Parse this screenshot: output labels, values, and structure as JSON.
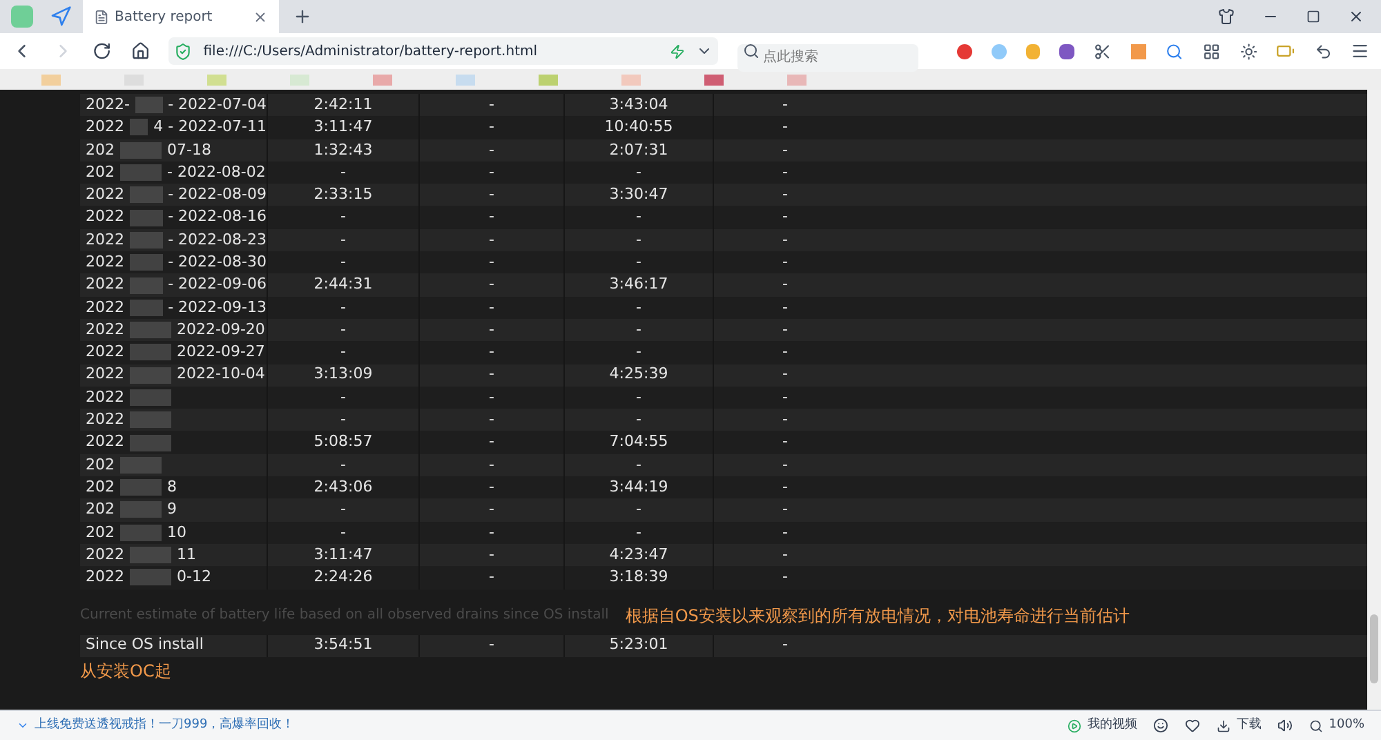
{
  "tab": {
    "title": "Battery report"
  },
  "address": "file:///C:/Users/Administrator/battery-report.html",
  "search": {
    "placeholder": "点此搜索"
  },
  "rows": [
    {
      "start": "2022-",
      "end": "- 2022-07-04",
      "c2": "2:42:11",
      "c3": "-",
      "c4": "3:43:04",
      "c5": "-"
    },
    {
      "start": "2022",
      "end": "4 - 2022-07-11",
      "c2": "3:11:47",
      "c3": "-",
      "c4": "10:40:55",
      "c5": "-"
    },
    {
      "start": "202",
      "end": "07-18",
      "c2": "1:32:43",
      "c3": "-",
      "c4": "2:07:31",
      "c5": "-"
    },
    {
      "start": "202",
      "end": "- 2022-08-02",
      "c2": "-",
      "c3": "-",
      "c4": "-",
      "c5": "-"
    },
    {
      "start": "2022",
      "end": "- 2022-08-09",
      "c2": "2:33:15",
      "c3": "-",
      "c4": "3:30:47",
      "c5": "-"
    },
    {
      "start": "2022",
      "end": "- 2022-08-16",
      "c2": "-",
      "c3": "-",
      "c4": "-",
      "c5": "-"
    },
    {
      "start": "2022",
      "end": "- 2022-08-23",
      "c2": "-",
      "c3": "-",
      "c4": "-",
      "c5": "-"
    },
    {
      "start": "2022",
      "end": "- 2022-08-30",
      "c2": "-",
      "c3": "-",
      "c4": "-",
      "c5": "-"
    },
    {
      "start": "2022",
      "end": "- 2022-09-06",
      "c2": "2:44:31",
      "c3": "-",
      "c4": "3:46:17",
      "c5": "-"
    },
    {
      "start": "2022",
      "end": "- 2022-09-13",
      "c2": "-",
      "c3": "-",
      "c4": "-",
      "c5": "-"
    },
    {
      "start": "2022",
      "end": "2022-09-20",
      "c2": "-",
      "c3": "-",
      "c4": "-",
      "c5": "-"
    },
    {
      "start": "2022",
      "end": "2022-09-27",
      "c2": "-",
      "c3": "-",
      "c4": "-",
      "c5": "-"
    },
    {
      "start": "2022",
      "end": "2022-10-04",
      "c2": "3:13:09",
      "c3": "-",
      "c4": "4:25:39",
      "c5": "-"
    },
    {
      "start": "2022",
      "c2": "-",
      "c3": "-",
      "c4": "-",
      "c5": "-"
    },
    {
      "start": "2022",
      "c2": "-",
      "c3": "-",
      "c4": "-",
      "c5": "-"
    },
    {
      "start": "2022",
      "c2": "5:08:57",
      "c3": "-",
      "c4": "7:04:55",
      "c5": "-"
    },
    {
      "start": "202",
      "c2": "-",
      "c3": "-",
      "c4": "-",
      "c5": "-"
    },
    {
      "start": "202",
      "end": "8",
      "c2": "2:43:06",
      "c3": "-",
      "c4": "3:44:19",
      "c5": "-"
    },
    {
      "start": "202",
      "end": "9",
      "c2": "-",
      "c3": "-",
      "c4": "-",
      "c5": "-"
    },
    {
      "start": "202",
      "end": "10",
      "c2": "-",
      "c3": "-",
      "c4": "-",
      "c5": "-"
    },
    {
      "start": "2022",
      "end": "11",
      "c2": "3:11:47",
      "c3": "-",
      "c4": "4:23:47",
      "c5": "-"
    },
    {
      "start": "2022",
      "end": "0-12",
      "c2": "2:24:26",
      "c3": "-",
      "c4": "3:18:39",
      "c5": "-"
    }
  ],
  "estimate": {
    "caption": "Current estimate of battery life based on all observed drains since OS install",
    "note": "根据自OS安装以来观察到的所有放电情况，对电池寿命进行当前估计",
    "row": {
      "start": "Since OS install",
      "c2": "3:54:51",
      "c3": "-",
      "c4": "5:23:01",
      "c5": "-"
    },
    "row_note": "从安装OC起"
  },
  "status_bar": {
    "ad": "上线免费送透视戒指！一刀999，高爆率回收！",
    "videos": "我的视频",
    "download": "下载",
    "zoom": "100%"
  }
}
